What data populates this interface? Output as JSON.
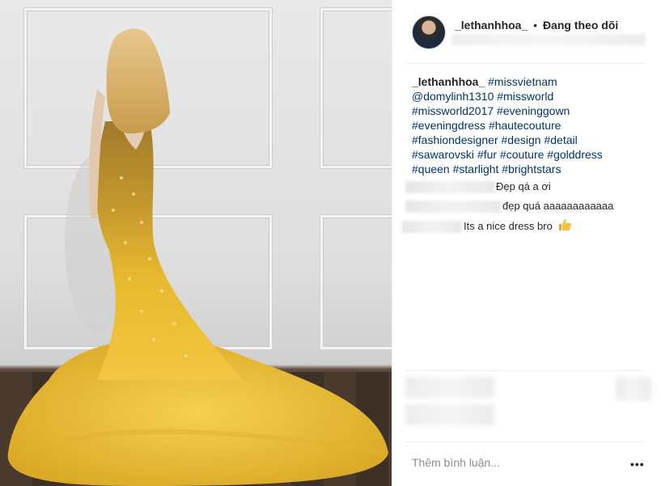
{
  "post": {
    "image_alt": "mannequin in golden feathered evening gown",
    "colors": {
      "link": "#003569",
      "text": "#262626",
      "muted": "#8e8e8e",
      "gown": "#e8b92e"
    }
  },
  "header": {
    "username": "_lethanhhoa_",
    "separator": "•",
    "follow_status": "Đang theo dõi"
  },
  "caption": {
    "owner": "_lethanhhoa_",
    "lines": [
      "#missvietnam",
      "@domylinh1310 #missworld",
      "#missworld2017 #eveninggown",
      "#eveningdress #hautecouture",
      "#fashiondesigner #design #detail",
      "#sawarovski #fur #couture #golddress",
      "#queen #starlight #brightstars"
    ]
  },
  "comments": [
    {
      "text": "Đẹp qá a ơi"
    },
    {
      "text": "đẹp quá aaaaaaaaaaaa"
    },
    {
      "text": "Its a nice dress bro",
      "emoji": "thumbs-up-icon"
    }
  ],
  "footer": {
    "placeholder": "Thêm bình luận...",
    "more_label": "•••"
  }
}
